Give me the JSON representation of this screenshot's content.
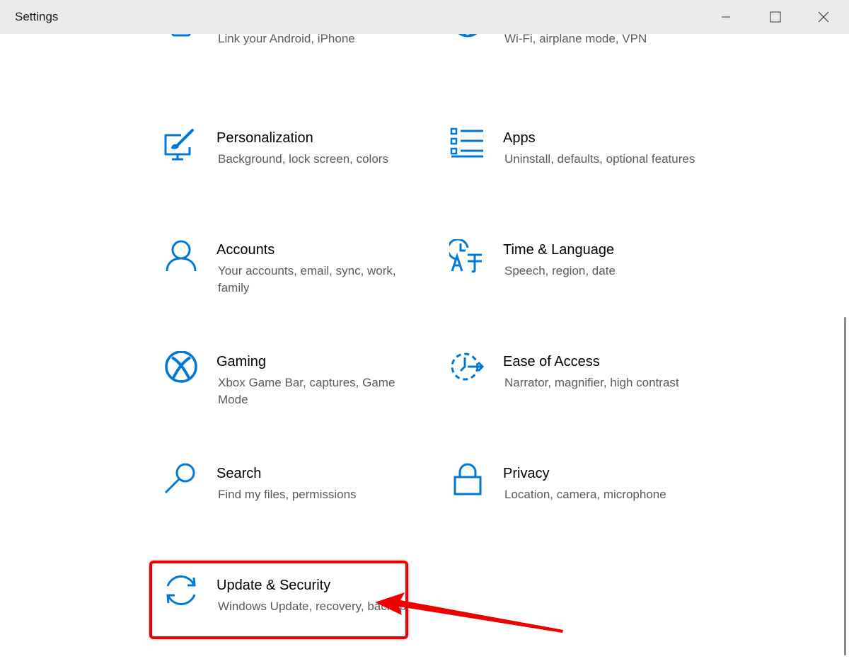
{
  "window": {
    "title": "Settings",
    "controls": [
      "minimize",
      "maximize",
      "close"
    ]
  },
  "accent_color": "#0078d7",
  "annotation_color": "#ee0000",
  "tiles": [
    {
      "name": "",
      "desc": "Link your Android, iPhone",
      "icon": "phone-icon"
    },
    {
      "name": "",
      "desc": "Wi-Fi, airplane mode, VPN",
      "icon": "globe-icon"
    },
    {
      "name": "Personalization",
      "desc": "Background, lock screen, colors",
      "icon": "personalization-icon"
    },
    {
      "name": "Apps",
      "desc": "Uninstall, defaults, optional features",
      "icon": "apps-icon"
    },
    {
      "name": "Accounts",
      "desc": "Your accounts, email, sync, work, family",
      "icon": "person-icon"
    },
    {
      "name": "Time & Language",
      "desc": "Speech, region, date",
      "icon": "time-language-icon"
    },
    {
      "name": "Gaming",
      "desc": "Xbox Game Bar, captures, Game Mode",
      "icon": "xbox-icon"
    },
    {
      "name": "Ease of Access",
      "desc": "Narrator, magnifier, high contrast",
      "icon": "ease-of-access-icon"
    },
    {
      "name": "Search",
      "desc": "Find my files, permissions",
      "icon": "search-icon"
    },
    {
      "name": "Privacy",
      "desc": "Location, camera, microphone",
      "icon": "lock-icon"
    },
    {
      "name": "Update & Security",
      "desc": "Windows Update, recovery, backup",
      "icon": "refresh-icon"
    }
  ]
}
